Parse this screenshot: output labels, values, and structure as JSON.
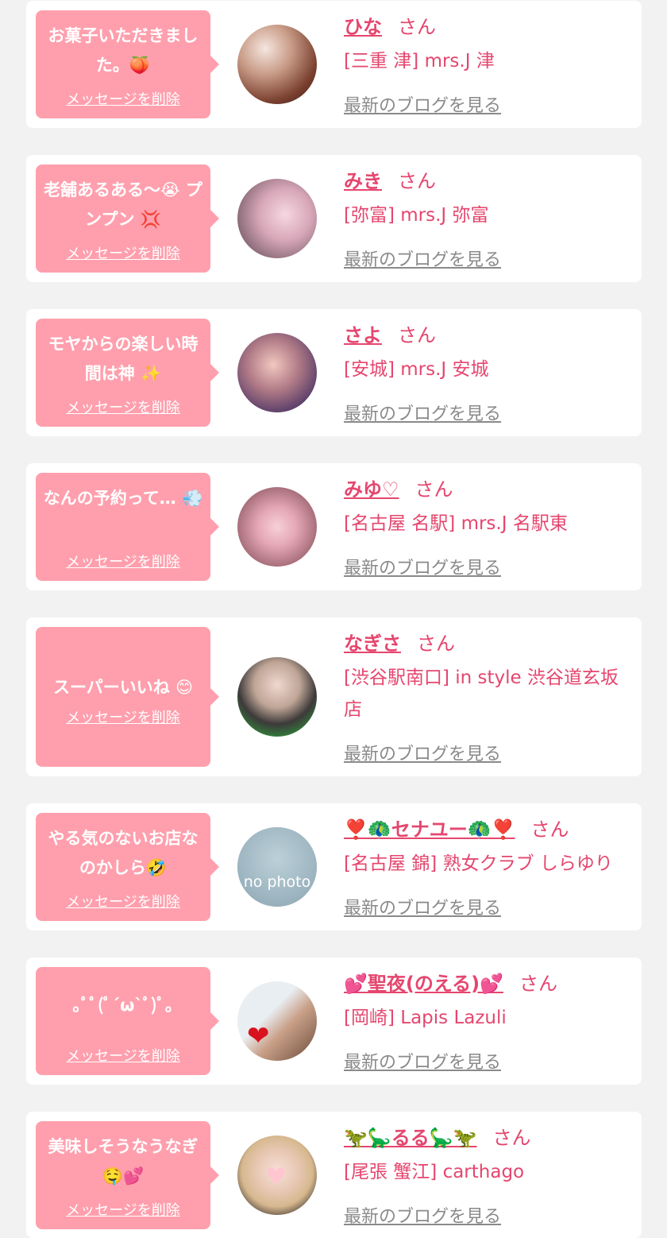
{
  "ui": {
    "delete_label": "メッセージを削除",
    "honorific": "さん",
    "blog_link_label": "最新のブログを見る",
    "no_photo_text": "no photo"
  },
  "colors": {
    "page_bg": "#f2f2f2",
    "bubble_bg": "#ff9fad",
    "name_pink": "#e5466e",
    "link_gray": "#8a8a8a"
  },
  "messages": [
    {
      "text": "お菓子いただきました。🍑",
      "name": "ひな",
      "shop": "[三重 津] mrs.J 津"
    },
    {
      "text": "老舗あるある〜😭 プンプン 💢",
      "name": "みき",
      "shop": "[弥富] mrs.J 弥富"
    },
    {
      "text": "モヤからの楽しい時間は神 ✨",
      "name": "さよ",
      "shop": "[安城] mrs.J 安城"
    },
    {
      "text": "なんの予約って… 💨",
      "name": "みゆ♡",
      "shop": "[名古屋 名駅] mrs.J 名駅東"
    },
    {
      "text": "スーパーいいね 😊",
      "name": "なぎさ",
      "shop": "[渋谷駅南口] in style 渋谷道玄坂店"
    },
    {
      "text": "やる気のないお店なのかしら🤣",
      "name": "❣️🦚セナユー🦚❣️",
      "shop": "[名古屋 錦] 熟女クラブ しらゆり"
    },
    {
      "text": "｡ﾟﾟ(ﾟ´ω`ﾟ)ﾟ｡",
      "name": "💕聖夜(のえる)💕",
      "shop": "[岡崎] Lapis Lazuli"
    },
    {
      "text": "美味しそうなうなぎ🤤💕",
      "name": "🦖🦕るる🦕🦖",
      "shop": "[尾張 蟹江] carthago"
    }
  ]
}
